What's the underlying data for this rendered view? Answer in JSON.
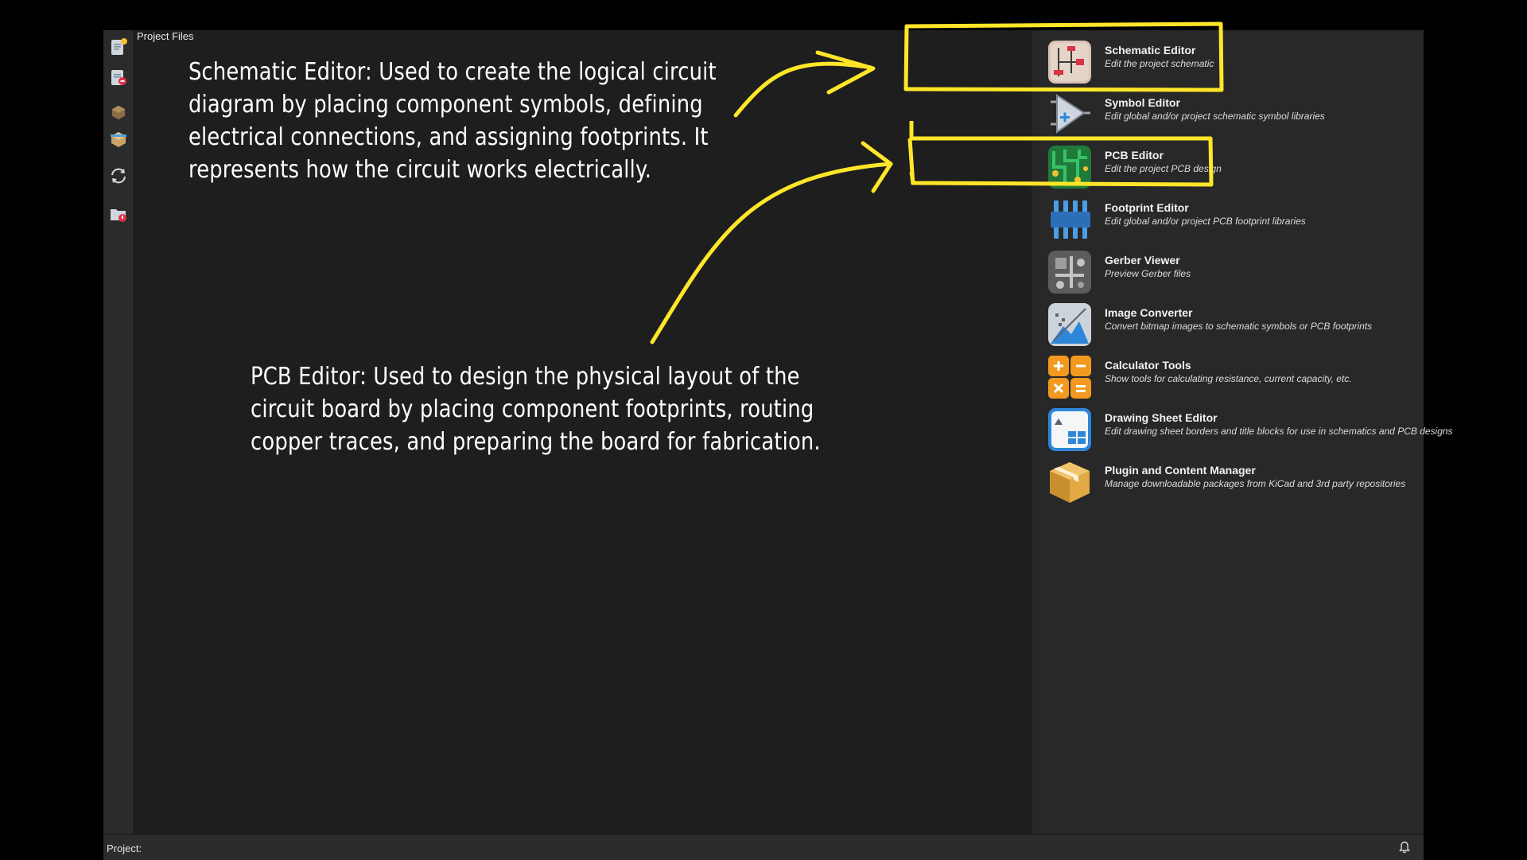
{
  "left_panel": {
    "title": "Project Files"
  },
  "toolbar": {
    "buttons": [
      {
        "icon": "new-project-icon"
      },
      {
        "icon": "new-from-template-icon"
      },
      {
        "icon": "open-project-icon"
      },
      {
        "icon": "open-demo-project-icon"
      },
      {
        "icon": "refresh-icon"
      },
      {
        "icon": "archive-project-icon"
      }
    ]
  },
  "launcher": {
    "items": [
      {
        "title": "Schematic Editor",
        "description": "Edit the project schematic",
        "icon": "schematic-editor-icon"
      },
      {
        "title": "Symbol Editor",
        "description": "Edit global and/or project schematic symbol libraries",
        "icon": "symbol-editor-icon"
      },
      {
        "title": "PCB Editor",
        "description": "Edit the project PCB design",
        "icon": "pcb-editor-icon"
      },
      {
        "title": "Footprint Editor",
        "description": "Edit global and/or project PCB footprint libraries",
        "icon": "footprint-editor-icon"
      },
      {
        "title": "Gerber Viewer",
        "description": "Preview Gerber files",
        "icon": "gerber-viewer-icon"
      },
      {
        "title": "Image Converter",
        "description": "Convert bitmap images to schematic symbols or PCB footprints",
        "icon": "image-converter-icon"
      },
      {
        "title": "Calculator Tools",
        "description": "Show tools for calculating resistance, current capacity, etc.",
        "icon": "calculator-tools-icon"
      },
      {
        "title": "Drawing Sheet Editor",
        "description": "Edit drawing sheet borders and title blocks for use in schematics and PCB designs",
        "icon": "drawing-sheet-editor-icon"
      },
      {
        "title": "Plugin and Content Manager",
        "description": "Manage downloadable packages from KiCad and 3rd party repositories",
        "icon": "plugin-content-manager-icon"
      }
    ]
  },
  "statusbar": {
    "project_label": "Project:",
    "icon": "bell-icon"
  },
  "annotations": {
    "schematic_note": [
      "Schematic Editor: Used to create the logical circuit",
      "diagram by placing component symbols, defining",
      "electrical connections, and assigning footprints. It",
      "represents how the circuit works electrically."
    ],
    "pcb_note": [
      "PCB Editor: Used to design the physical layout of the",
      "circuit board by placing component footprints, routing",
      "copper traces, and preparing the board for fabrication."
    ]
  },
  "colors": {
    "highlight": "#ffe629",
    "window_bg": "#1e1e1e",
    "launcher_bg": "#282828",
    "toolbar_bg": "#2b2b2b"
  }
}
